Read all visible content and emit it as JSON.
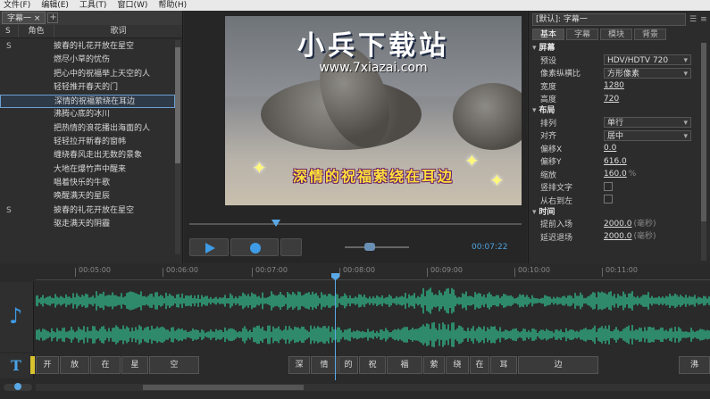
{
  "menu": [
    "文件(F)",
    "编辑(E)",
    "工具(T)",
    "窗口(W)",
    "帮助(H)"
  ],
  "left_panel": {
    "tab_label": "字幕一 ×",
    "tab_add": "+",
    "headers": {
      "s": "S",
      "role": "角色",
      "lyrics": "歌词"
    },
    "rows": [
      {
        "s": "S",
        "lyric": "披春的礼花开放在星空"
      },
      {
        "s": "",
        "lyric": "燃尽小草的忧伤"
      },
      {
        "s": "",
        "lyric": "把心中的祝福举上天空的人"
      },
      {
        "s": "",
        "lyric": "轻轻推开春天的门"
      },
      {
        "s": "",
        "lyric": "深情的祝福萦绕在耳边"
      },
      {
        "s": "",
        "lyric": "沸腾心底的冰川"
      },
      {
        "s": "",
        "lyric": "把热情的浪花播出海面的人"
      },
      {
        "s": "",
        "lyric": "轻轻拉开新春的窗帏"
      },
      {
        "s": "",
        "lyric": "缠绕春风走出无数的景象"
      },
      {
        "s": "",
        "lyric": "大地在爆竹声中醒来"
      },
      {
        "s": "",
        "lyric": "唱着快乐的牛歌"
      },
      {
        "s": "",
        "lyric": "唤醒满天的星辰"
      },
      {
        "s": "S",
        "lyric": "披春的礼花开放在星空"
      },
      {
        "s": "",
        "lyric": "驱走满天的阴霾"
      }
    ],
    "selected_index": 4
  },
  "preview": {
    "watermark_title": "小兵下载站",
    "watermark_url": "www.7xiazai.com",
    "subtitle": "深情的祝福萦绕在耳边",
    "timecode": "00:07:22"
  },
  "right_panel": {
    "preset": "[默认]: 字幕一",
    "tabs": [
      "基本",
      "字幕",
      "模块",
      "背景"
    ],
    "active_tab": 0,
    "sections": [
      {
        "title": "屏幕",
        "props": [
          {
            "label": "预设",
            "value": "HDV/HDTV 720",
            "type": "dropdown"
          },
          {
            "label": "像素纵横比",
            "value": "方形像素",
            "type": "dropdown"
          },
          {
            "label": "宽度",
            "value": "1280",
            "type": "number"
          },
          {
            "label": "高度",
            "value": "720",
            "type": "number"
          }
        ]
      },
      {
        "title": "布局",
        "props": [
          {
            "label": "排列",
            "value": "单行",
            "type": "dropdown"
          },
          {
            "label": "对齐",
            "value": "居中",
            "type": "dropdown"
          },
          {
            "label": "偏移X",
            "value": "0.0",
            "type": "number"
          },
          {
            "label": "偏移Y",
            "value": "616.0",
            "type": "number"
          },
          {
            "label": "缩放",
            "value": "160.0",
            "type": "number",
            "unit": "%"
          },
          {
            "label": "竖排文字",
            "value": "",
            "type": "checkbox"
          },
          {
            "label": "从右到左",
            "value": "",
            "type": "checkbox"
          }
        ]
      },
      {
        "title": "时间",
        "props": [
          {
            "label": "提前入场",
            "value": "2000.0",
            "type": "number",
            "unit": "(毫秒)"
          },
          {
            "label": "延迟退场",
            "value": "2000.0",
            "type": "number",
            "unit": "(毫秒)"
          }
        ]
      }
    ]
  },
  "timeline": {
    "ticks": [
      "00:05:00",
      "00:06:00",
      "00:07:00",
      "00:08:00",
      "00:09:00",
      "00:10:00",
      "00:11:00"
    ],
    "clips": [
      "开",
      "放",
      "在",
      "星",
      "空",
      "深",
      "情",
      "的",
      "祝",
      "福",
      "萦",
      "绕",
      "在",
      "耳",
      "边",
      "沸"
    ]
  }
}
